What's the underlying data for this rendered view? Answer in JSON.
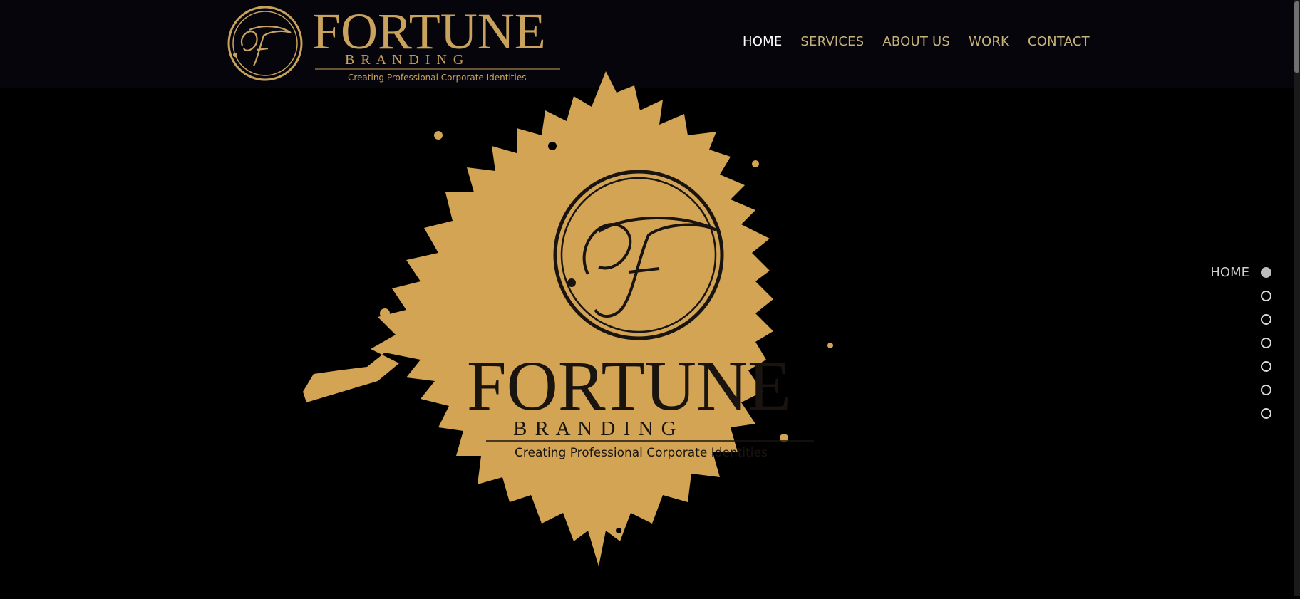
{
  "brand": {
    "name": "FORTUNE",
    "sub": "B R A N D I N G",
    "tagline": "Creating Professional Corporate Identities",
    "monogram": "F",
    "gold": "#d3a454",
    "gold_logo": "#c9a35e",
    "dark": "#1a1410"
  },
  "nav": {
    "items": [
      {
        "label": "HOME",
        "active": true
      },
      {
        "label": "SERVICES"
      },
      {
        "label": "ABOUT US"
      },
      {
        "label": "WORK"
      },
      {
        "label": "CONTACT"
      }
    ]
  },
  "side_nav": {
    "active_label": "HOME",
    "count": 7
  },
  "colors": {
    "header_bg": "#06050b",
    "nav_text": "#c7b37a",
    "nav_active": "#ffffff"
  }
}
